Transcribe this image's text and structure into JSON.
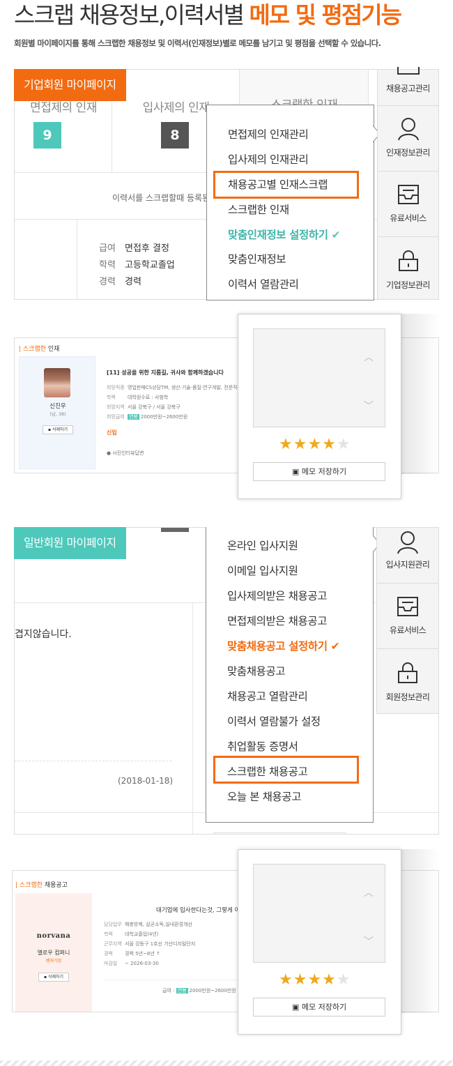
{
  "header": {
    "title_plain": "스크랩 채용정보,이력서별 ",
    "title_highlight": "메모 및 평점기능",
    "subtitle": "회원별 마이페이지를 통해 스크랩한 채용정보 및 이력서(인재정보)별로 메모를 남기고 및 평점을 선택할 수 있습니다."
  },
  "company_mypage": {
    "tag": "기업회원 마이페이지",
    "columns": [
      {
        "label": "면접제의 인재",
        "count": "9"
      },
      {
        "label": "입사제의 인재",
        "count": "8"
      },
      {
        "label": "스크랩한 인재"
      }
    ],
    "note": "이력서를 스크랩할때 등록된",
    "info": [
      {
        "k": "급여",
        "v": "면접후 결정"
      },
      {
        "k": "학력",
        "v": "고등학교졸업"
      },
      {
        "k": "경력",
        "v": "경력"
      }
    ],
    "menu": [
      "면접제의 인재관리",
      "입사제의 인재관리",
      "채용공고별 인재스크랩",
      "스크랩한 인재",
      "맞춤인재정보 설정하기",
      "맞춤인재정보",
      "이력서 열람관리"
    ],
    "menu_check": "✔",
    "iconbar": [
      {
        "label": "채용공고관리",
        "icon": "tray-icon"
      },
      {
        "label": "인재정보관리",
        "icon": "person-icon"
      },
      {
        "label": "유료서비스",
        "icon": "inbox-icon"
      },
      {
        "label": "기업정보관리",
        "icon": "lock-icon"
      }
    ]
  },
  "scrap_talent": {
    "heading_accent": "| 스크랩한",
    "heading_rest": " 인재",
    "person_name": "신진우",
    "person_sub": "(남, 38)",
    "delete_btn": "삭제하기",
    "post_title": "[11] 성공을 위한 지름길, 귀사와 함께하겠습니다",
    "rows": [
      {
        "k": "희망직종",
        "v": "영업판매CS상담TM, 생산·기술·품질·연구개발, 전문직"
      },
      {
        "k": "학력",
        "v": "대학원수료 : 사범학"
      },
      {
        "k": "희망지역",
        "v": "서울 강북구 / 서울 강북구"
      },
      {
        "k": "희망급여",
        "v": "2000만원~2600만원"
      }
    ],
    "pay_badge": "연봉",
    "status": "신입",
    "footnote": "사진인터뷰답변",
    "memo_btn": "메모 저장하기",
    "rating": 4,
    "rating_max": 5
  },
  "user_mypage": {
    "tag": "일반회원 마이페이지",
    "notice": "겹지않습니다.",
    "date": "(2018-01-18)",
    "menu": [
      "온라인 입사지원",
      "이메일 입사지원",
      "입사제의받은 채용공고",
      "면접제의받은 채용공고",
      "맞춤채용공고 설정하기",
      "맞춤채용공고",
      "채용공고 열람관리",
      "이력서 열람불가 설정",
      "취업활동 증명서",
      "스크랩한 채용공고",
      "오늘 본 채용공고"
    ],
    "menu_check": "✔",
    "iconbar": [
      {
        "label": "입사지원관리",
        "icon": "person-icon"
      },
      {
        "label": "유료서비스",
        "icon": "inbox-icon"
      },
      {
        "label": "회원정보관리",
        "icon": "lock-icon"
      }
    ]
  },
  "scrap_job": {
    "heading_accent": "| 스크랩한",
    "heading_rest": " 채용공고",
    "logo_text": "norvana",
    "company": "엘로우 컴퍼니",
    "company_type": "벤처기업",
    "delete_btn": "삭제하기",
    "post_title": "대기업에 입사한다는것, 그렇게 어",
    "rows": [
      {
        "k": "담당업무",
        "v": "해충방제, 살균소독,실내환경개선"
      },
      {
        "k": "학력",
        "v": "대학교졸업(4년)"
      },
      {
        "k": "근무지역",
        "v": "서울 강동구   1호선 가산디지털단지"
      },
      {
        "k": "경력",
        "v": "경력 5년~8년 ↑"
      },
      {
        "k": "마감일",
        "v": "~ 2026-03-30"
      }
    ],
    "pay_label": "급여 : ",
    "pay_badge": "연봉",
    "pay_value": "2000만원~2600만원",
    "memo_btn": "메모 저장하기",
    "rating": 4,
    "rating_max": 5
  },
  "colors": {
    "accent_orange": "#f26b10",
    "accent_teal": "#4dc8bb",
    "star": "#f0a81e"
  }
}
